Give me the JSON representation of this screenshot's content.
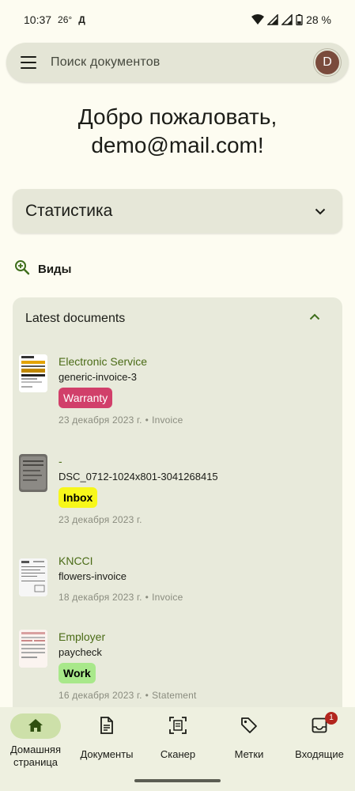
{
  "status_bar": {
    "time": "10:37",
    "temperature": "26°",
    "indicator": "Д",
    "battery": "28 %"
  },
  "search": {
    "placeholder": "Поиск документов",
    "avatar_letter": "D"
  },
  "welcome": {
    "line1": "Добро пожаловать,",
    "line2": "demo@mail.com!"
  },
  "stats": {
    "title": "Статистика"
  },
  "views": {
    "label": "Виды"
  },
  "latest": {
    "header": "Latest documents",
    "documents": [
      {
        "correspondent": "Electronic Service",
        "title": "generic-invoice-3",
        "tag": "Warranty",
        "tag_bg": "#d13f6a",
        "tag_color": "#ffffff",
        "date": "23 декабря 2023 г.",
        "type": "Invoice"
      },
      {
        "correspondent": "-",
        "title": "DSC_0712-1024x801-3041268415",
        "tag": "Inbox",
        "tag_bg": "#f7f71a",
        "tag_color": "#000000",
        "date": "23 декабря 2023 г.",
        "type": ""
      },
      {
        "correspondent": "KNCCI",
        "title": "flowers-invoice",
        "tag": "",
        "date": "18 декабря 2023 г.",
        "type": "Invoice"
      },
      {
        "correspondent": "Employer",
        "title": "paycheck",
        "tag": "Work",
        "tag_bg": "#a8e88a",
        "tag_color": "#000000",
        "date": "16 декабря 2023 г.",
        "type": "Statement"
      }
    ]
  },
  "bottom_nav": {
    "items": [
      {
        "label": "Домашняя страница",
        "icon": "home-icon"
      },
      {
        "label": "Документы",
        "icon": "document-icon"
      },
      {
        "label": "Сканер",
        "icon": "scanner-icon"
      },
      {
        "label": "Метки",
        "icon": "tag-icon"
      },
      {
        "label": "Входящие",
        "icon": "inbox-icon"
      }
    ],
    "inbox_badge": "1"
  },
  "colors": {
    "accent": "#4a6b16",
    "background": "#fdfcf1",
    "nav_active": "#cde0a9"
  }
}
